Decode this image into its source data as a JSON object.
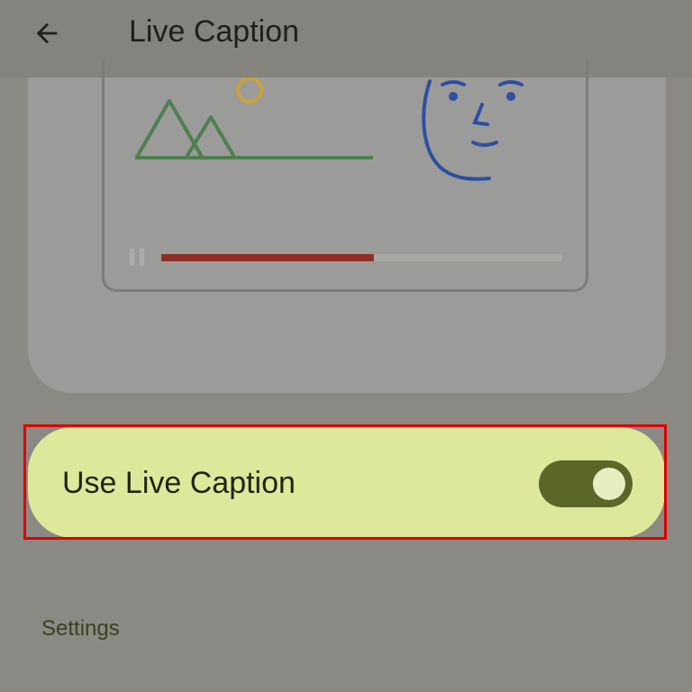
{
  "app_bar": {
    "back_icon": "arrow-back-icon",
    "title": "Live Caption"
  },
  "illustration": {
    "icons": [
      "sun-icon",
      "mountains-icon",
      "face-icon",
      "pause-icon"
    ],
    "progress_fraction": 0.53,
    "colors": {
      "sun": "#c9a23a",
      "mountains": "#4f7f50",
      "face": "#2f4fa0",
      "progress_fill": "#8f2f25",
      "progress_track": "#a8a8a5"
    }
  },
  "toggle": {
    "label": "Use Live Caption",
    "checked": true,
    "colors": {
      "card": "#dde89a",
      "track": "#5b6629",
      "thumb": "#e6eec0"
    }
  },
  "settings": {
    "header": "Settings"
  }
}
